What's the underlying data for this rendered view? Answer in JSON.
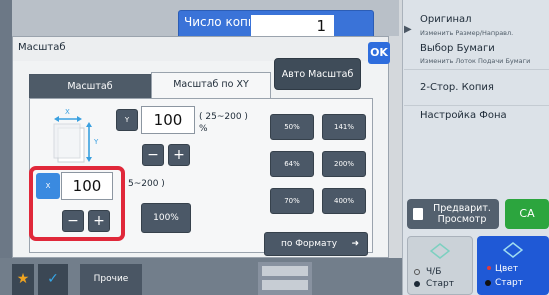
{
  "top": {
    "copies_label": "Число копий",
    "copies_value": "1"
  },
  "right_panel": {
    "items": [
      {
        "main": "Оригинал",
        "sub": "Изменить Размер/Направл."
      },
      {
        "main": "Выбор Бумаги",
        "sub": "Изменить Лоток Подачи Бумаги"
      },
      {
        "main": "2-Стор. Копия",
        "sub": ""
      },
      {
        "main": "Настройка Фона",
        "sub": ""
      }
    ],
    "preview_label_1": "Предварит.",
    "preview_label_2": "Просмотр",
    "ca_label": "CA",
    "bw_label": "Ч/Б",
    "bw_start": "Старт",
    "color_label": "Цвет",
    "color_start": "Старт"
  },
  "dialog": {
    "title": "Масштаб",
    "ok_label": "OK",
    "tabs": [
      {
        "label": "Масштаб",
        "active": false
      },
      {
        "label": "Масштаб по XY",
        "active": true
      }
    ],
    "auto_label": "Авто Масштаб",
    "diagram": {
      "x_label": "X",
      "y_label": "Y"
    },
    "y": {
      "letter": "Y",
      "value": "100",
      "range": "( 25~200 )",
      "unit": "%",
      "minus": "−",
      "plus": "+"
    },
    "x": {
      "letter": "X",
      "value": "100",
      "range": "5~200 )",
      "minus": "−",
      "plus": "+"
    },
    "btn_100": "100%",
    "presets": [
      "50%",
      "141%",
      "64%",
      "200%",
      "70%",
      "400%"
    ],
    "by_format": "по Формату"
  },
  "bottom": {
    "other_label": "Прочие"
  },
  "colors": {
    "accent_blue": "#2e6ddd",
    "highlight_red": "#e0283a",
    "ca_green": "#2ca53e"
  }
}
